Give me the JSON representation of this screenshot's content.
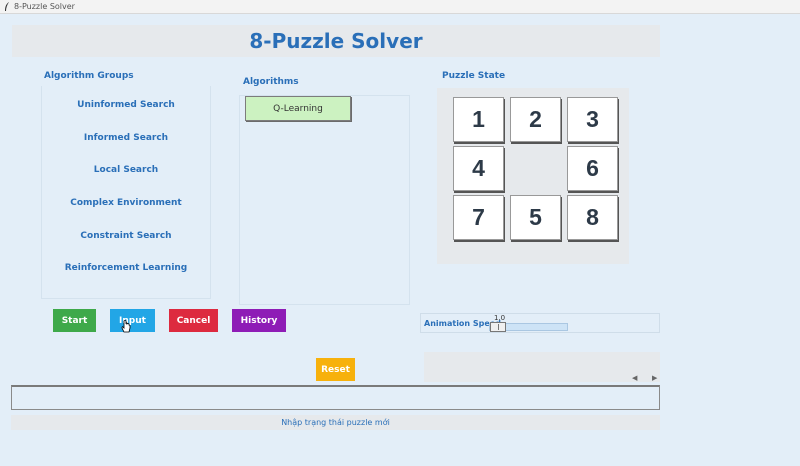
{
  "window": {
    "title": "8-Puzzle Solver"
  },
  "header": {
    "title": "8-Puzzle Solver"
  },
  "algorithm_groups": {
    "title": "Algorithm Groups",
    "items": [
      "Uninformed Search",
      "Informed Search",
      "Local Search",
      "Complex Environment",
      "Constraint Search",
      "Reinforcement Learning"
    ]
  },
  "algorithms": {
    "title": "Algorithms",
    "items": [
      "Q-Learning"
    ]
  },
  "puzzle": {
    "title": "Puzzle State",
    "tiles": [
      "1",
      "2",
      "3",
      "4",
      "",
      "6",
      "7",
      "5",
      "8"
    ]
  },
  "controls": {
    "start": "Start",
    "input": "Input",
    "cancel": "Cancel",
    "history": "History",
    "reset": "Reset"
  },
  "speed": {
    "label": "Animation Speed",
    "value": "1.0",
    "level": 0
  },
  "input_bar": {
    "value": ""
  },
  "status": {
    "text": "Nhập trạng thái puzzle mới"
  },
  "colors": {
    "accent": "#2a6fb8",
    "start": "#3ea94a",
    "input": "#22a6e6",
    "cancel": "#dd2a3f",
    "history": "#8e1cb6",
    "reset": "#f7b10c",
    "algorithm_button": "#ccf2c1"
  },
  "icons": {
    "window": "feather-icon",
    "scroll_left": "scroll-left-icon",
    "scroll_right": "scroll-right-icon",
    "cursor": "hand-cursor-icon"
  }
}
